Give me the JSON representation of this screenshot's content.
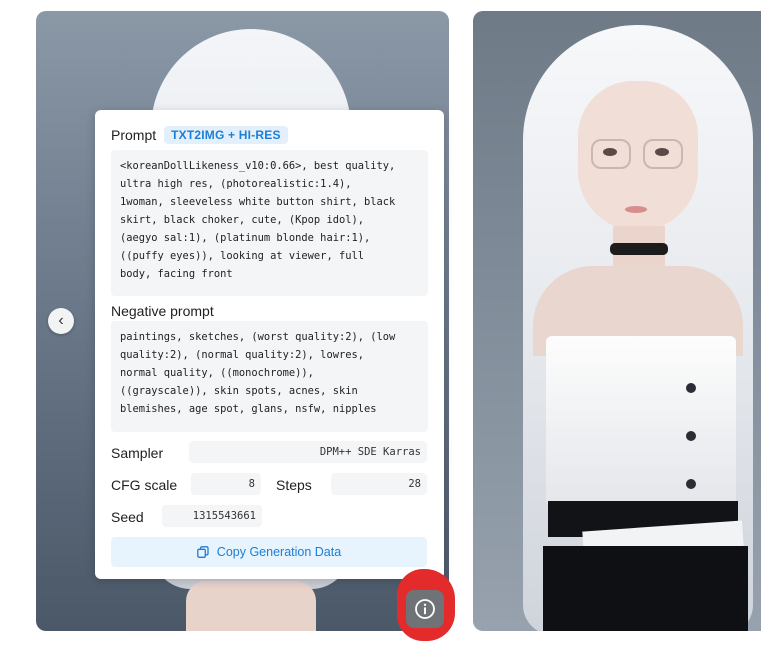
{
  "gallery": {
    "nav_prev_icon": "chevron-left-icon",
    "nav_prev_glyph": "‹",
    "info_icon": "info-circle-icon"
  },
  "generation_panel": {
    "prompt_label": "Prompt",
    "mode_badge": "TXT2IMG + HI-RES",
    "prompt_text": "<koreanDollLikeness_v10:0.66>, best quality,\nultra high res, (photorealistic:1.4),\n1woman, sleeveless white button shirt, black\nskirt, black choker, cute, (Kpop idol),\n(aegyo sal:1), (platinum blonde hair:1),\n((puffy eyes)), looking at viewer, full\nbody, facing front",
    "negative_label": "Negative prompt",
    "negative_text": "paintings, sketches, (worst quality:2), (low\nquality:2), (normal quality:2), lowres,\nnormal quality, ((monochrome)),\n((grayscale)), skin spots, acnes, skin\nblemishes, age spot, glans, nsfw, nipples",
    "sampler_label": "Sampler",
    "sampler_value": "DPM++ SDE Karras",
    "cfg_label": "CFG scale",
    "cfg_value": "8",
    "steps_label": "Steps",
    "steps_value": "28",
    "seed_label": "Seed",
    "seed_value": "1315543661",
    "copy_button_label": "Copy Generation Data",
    "copy_icon": "copy-icon"
  },
  "colors": {
    "accent": "#1c7ed6",
    "badge_bg": "#e3f0fb",
    "highlight_marker": "#e32b2b"
  }
}
